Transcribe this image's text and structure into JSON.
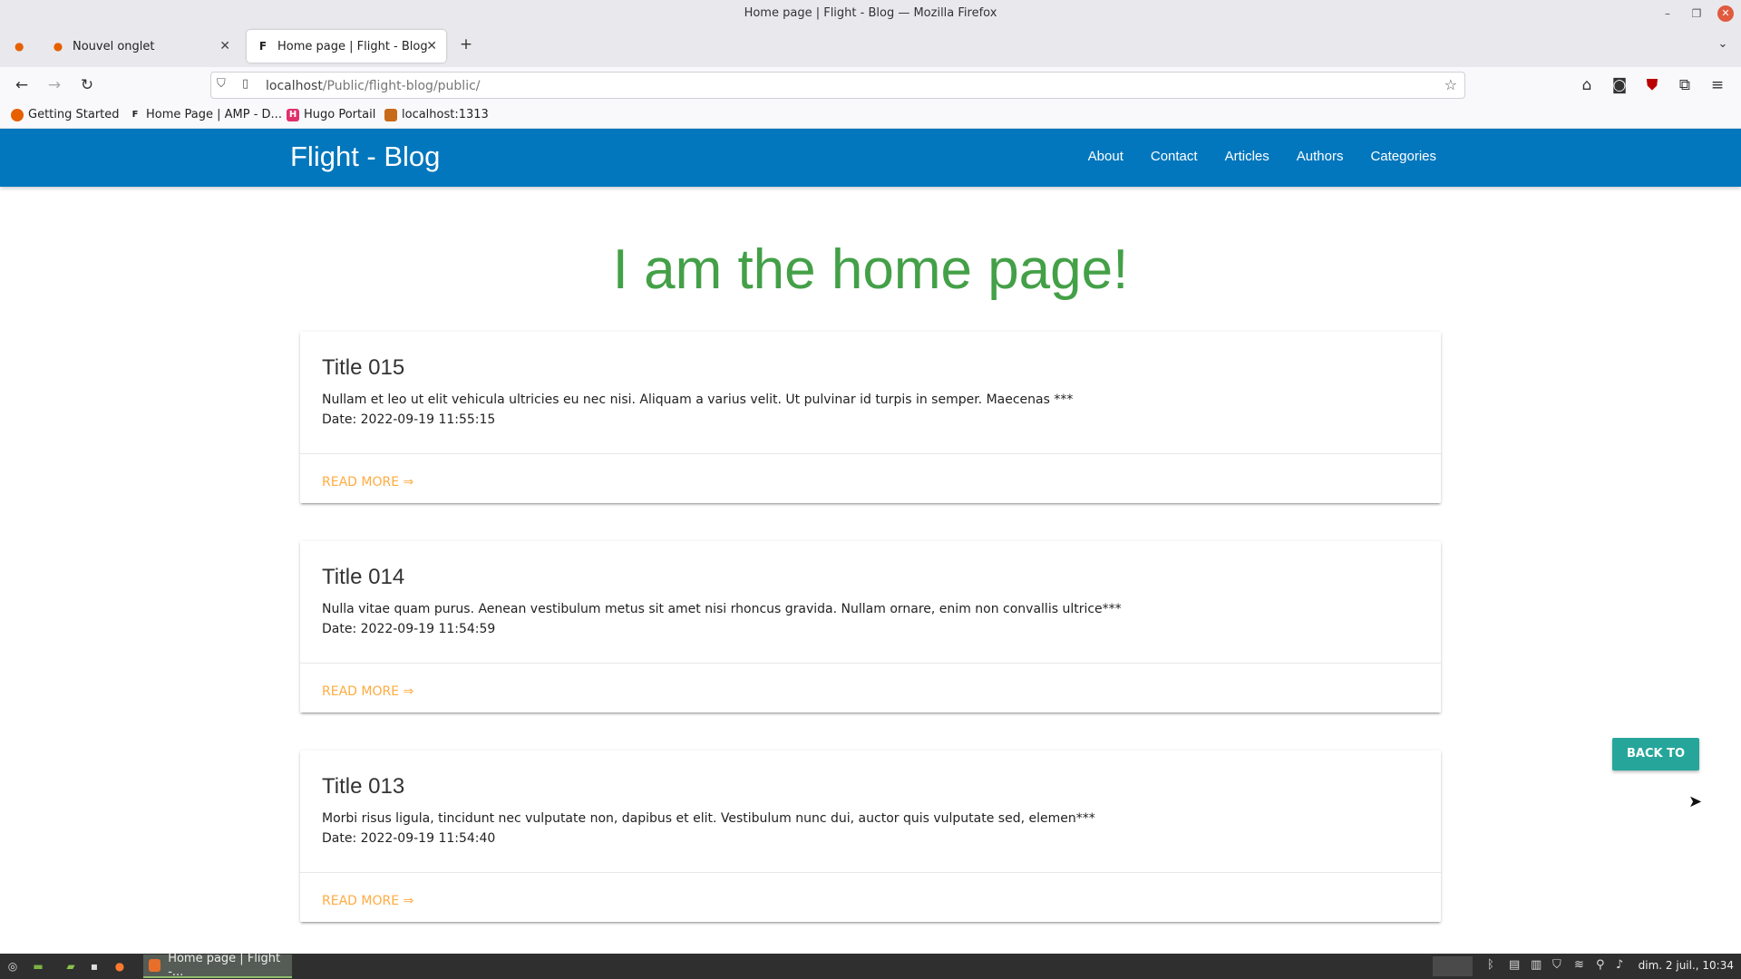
{
  "window": {
    "title": "Home page | Flight - Blog — Mozilla Firefox"
  },
  "tabs": [
    {
      "label": "Nouvel onglet"
    },
    {
      "label": "Home page | Flight - Blog"
    }
  ],
  "urlbar": {
    "host": "localhost",
    "path": "/Public/flight-blog/public/"
  },
  "bookmarks": [
    {
      "label": "Getting Started",
      "icon": "firefox-icon"
    },
    {
      "label": "Home Page | AMP - D...",
      "icon": "F"
    },
    {
      "label": "Hugo Portail",
      "icon": "H"
    },
    {
      "label": "localhost:1313",
      "icon": "localhost-icon"
    }
  ],
  "site": {
    "brand": "Flight - Blog",
    "nav": [
      "About",
      "Contact",
      "Articles",
      "Authors",
      "Categories"
    ],
    "hero": "I am the home page!",
    "colors": {
      "header": "#0277bd",
      "hero": "#43a047",
      "link": "#ffab40",
      "backtop": "#26a69a"
    }
  },
  "articles": [
    {
      "title": "Title 015",
      "excerpt": "Nullam et leo ut elit vehicula ultricies eu nec nisi. Aliquam a varius velit. Ut pulvinar id turpis in semper. Maecenas ***",
      "date": "Date: 2022-09-19 11:55:15",
      "more": "READ MORE ⇒"
    },
    {
      "title": "Title 014",
      "excerpt": "Nulla vitae quam purus. Aenean vestibulum metus sit amet nisi rhoncus gravida. Nullam ornare, enim non convallis ultrice***",
      "date": "Date: 2022-09-19 11:54:59",
      "more": "READ MORE ⇒"
    },
    {
      "title": "Title 013",
      "excerpt": "Morbi risus ligula, tincidunt nec vulputate non, dapibus et elit. Vestibulum nunc dui, auctor quis vulputate sed, elemen***",
      "date": "Date: 2022-09-19 11:54:40",
      "more": "READ MORE ⇒"
    }
  ],
  "back_to_top": "BACK TO TOP",
  "taskbar": {
    "window_label": "Home page | Flight -...",
    "clock": "dim. 2 juil., 10:34"
  }
}
